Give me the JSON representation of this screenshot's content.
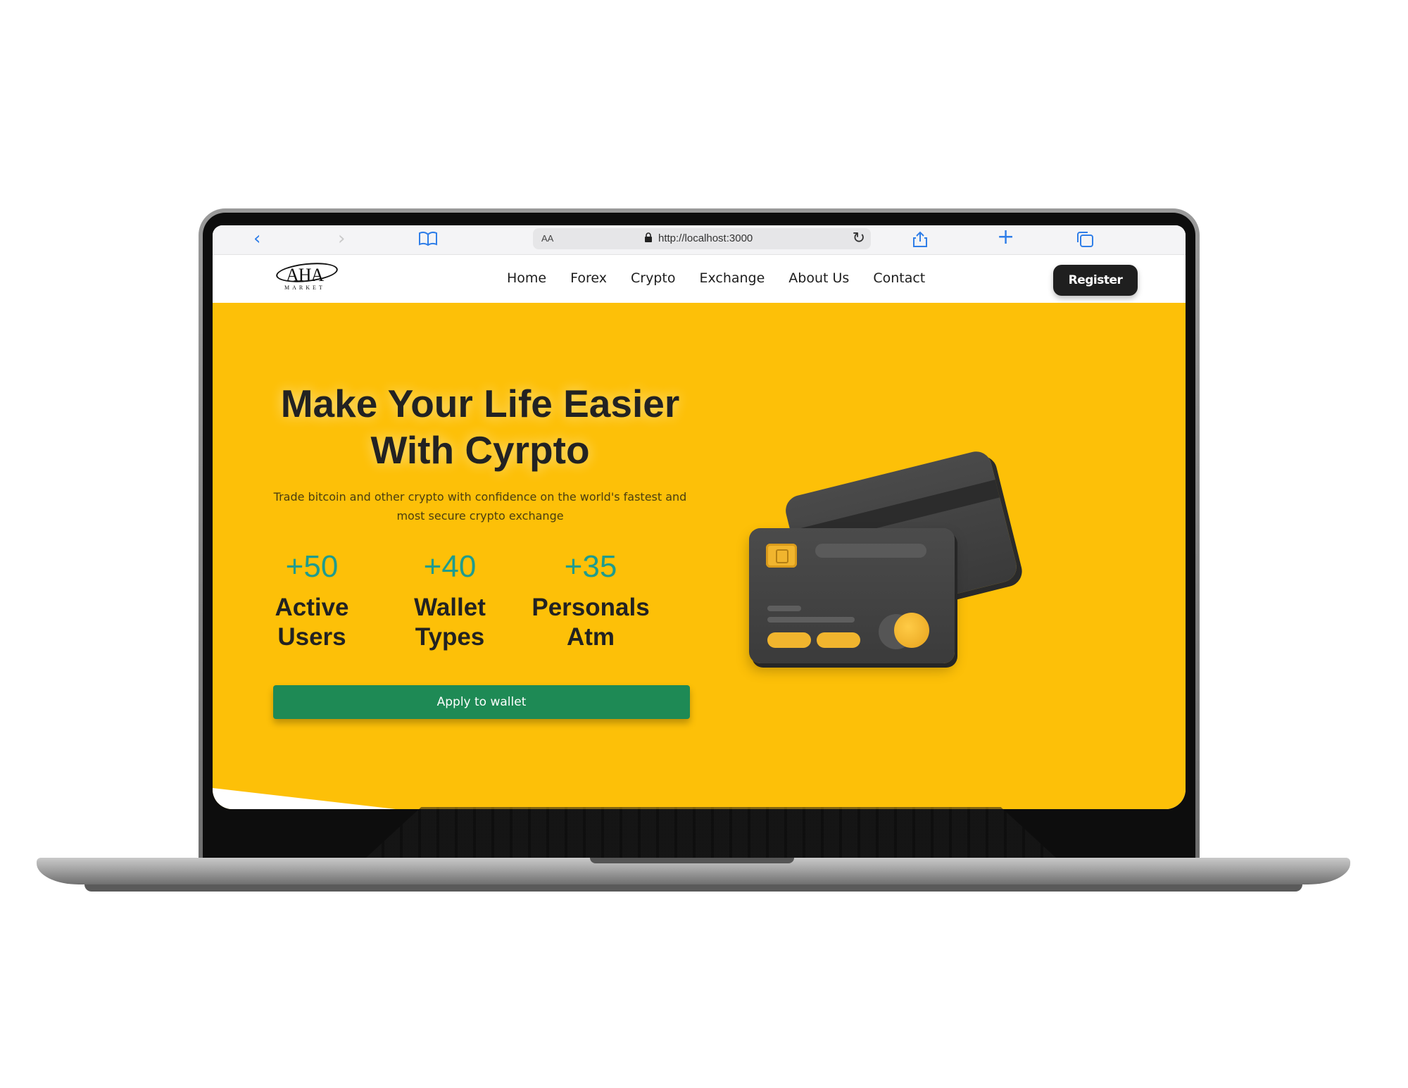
{
  "browser": {
    "aa_label": "AA",
    "url": "http://localhost:3000"
  },
  "site": {
    "logo_text": "AHA",
    "logo_subtext": "MARKET",
    "nav_items": [
      "Home",
      "Forex",
      "Crypto",
      "Exchange",
      "About Us",
      "Contact"
    ],
    "register_label": "Register"
  },
  "hero": {
    "title_line1": "Make Your Life Easier",
    "title_line2": "With Cyrpto",
    "subtitle_line1": "Trade bitcoin and other crypto with confidence on the world's fastest and",
    "subtitle_line2": "most secure crypto exchange",
    "stats": [
      {
        "value": "+50",
        "label_line1": "Active",
        "label_line2": "Users"
      },
      {
        "value": "+40",
        "label_line1": "Wallet",
        "label_line2": "Types"
      },
      {
        "value": "+35",
        "label_line1": "Personals",
        "label_line2": "Atm"
      }
    ],
    "apply_label": "Apply to wallet"
  },
  "colors": {
    "hero_background": "#fdc008",
    "stat_value": "#1f9c8e",
    "apply_button": "#1e8a55",
    "register_button": "#1f1f1f",
    "browser_icon": "#2f7ee8"
  },
  "icons": {
    "back": "chevron-left-icon",
    "forward": "chevron-right-icon",
    "bookmarks": "book-icon",
    "lock": "lock-icon",
    "reload": "reload-icon",
    "share": "share-icon",
    "new_tab": "plus-icon",
    "tabs": "tabs-icon"
  }
}
